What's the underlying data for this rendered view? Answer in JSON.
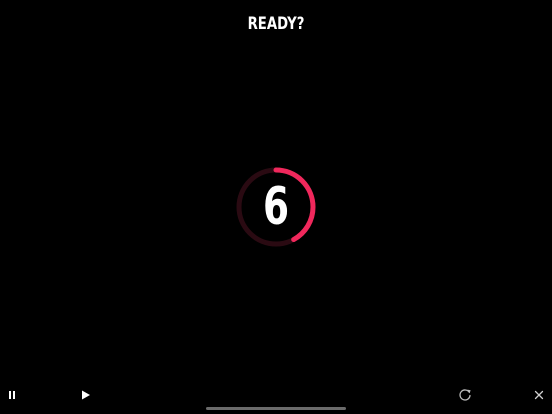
{
  "screen": {
    "title": "READY?"
  },
  "countdown": {
    "value": "6",
    "progress": 0.42,
    "colors": {
      "progress": "#f0285c",
      "track": "#2a0a12"
    }
  },
  "controls": {
    "pause": {
      "icon": "pause-icon"
    },
    "play": {
      "icon": "play-icon"
    },
    "restart": {
      "icon": "restart-icon"
    },
    "close": {
      "icon": "close-icon"
    }
  }
}
